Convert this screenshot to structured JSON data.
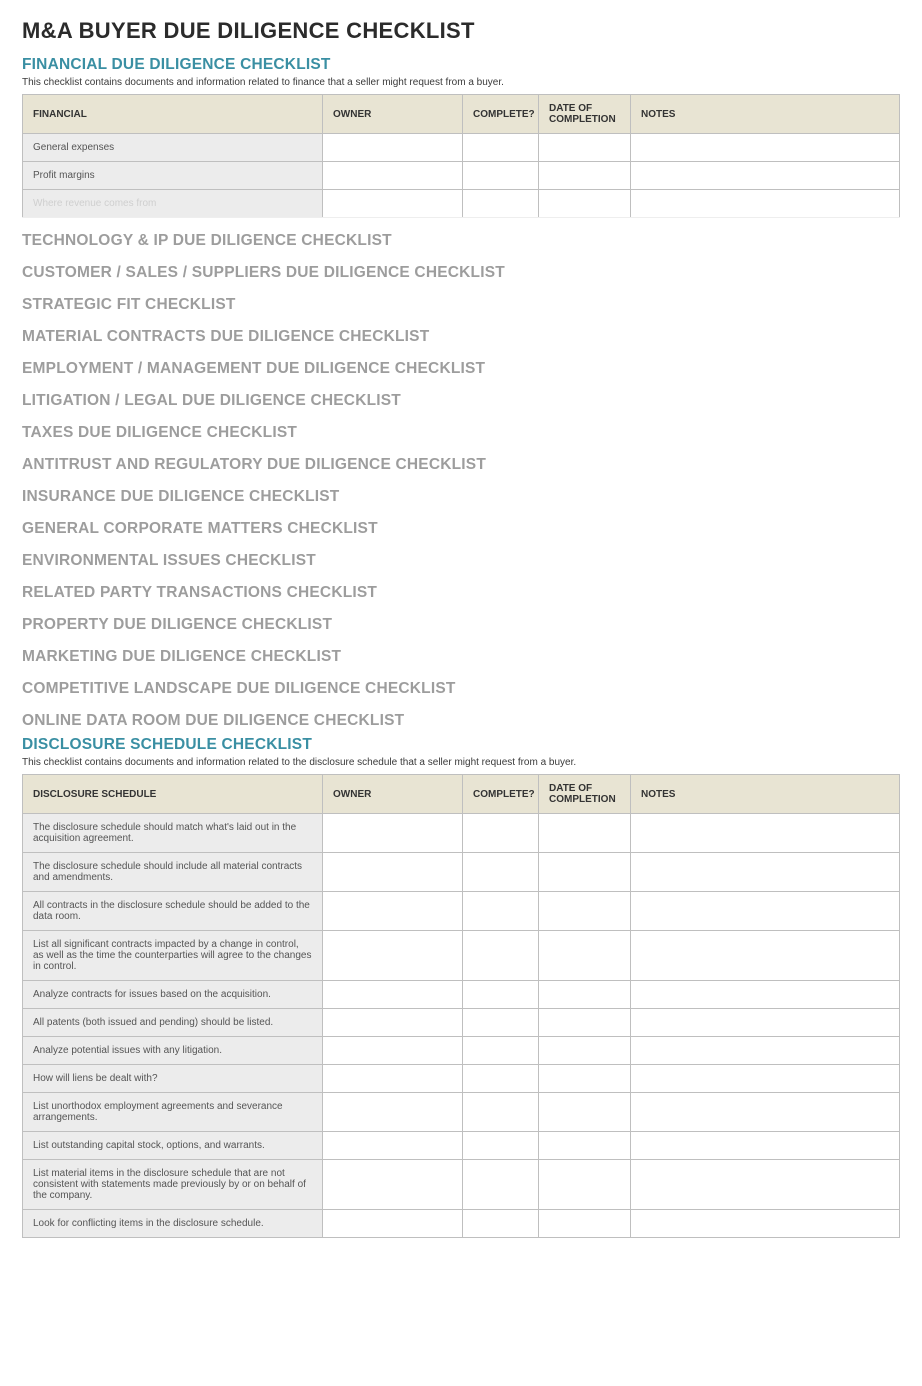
{
  "title": "M&A BUYER DUE DILIGENCE CHECKLIST",
  "columns": {
    "owner": "OWNER",
    "complete": "COMPLETE?",
    "date": "DATE OF COMPLETION",
    "notes": "NOTES"
  },
  "financial": {
    "heading": "FINANCIAL DUE DILIGENCE CHECKLIST",
    "desc": "This checklist contains documents and information related to finance that a seller might request from a buyer.",
    "colhead": "FINANCIAL",
    "rows": [
      {
        "label": "General expenses",
        "owner": "",
        "complete": "",
        "date": "",
        "notes": ""
      },
      {
        "label": "Profit margins",
        "owner": "",
        "complete": "",
        "date": "",
        "notes": ""
      },
      {
        "label": "Where revenue comes from",
        "owner": "",
        "complete": "",
        "date": "",
        "notes": "",
        "fade": true
      }
    ]
  },
  "collapsed_sections": [
    "TECHNOLOGY & IP DUE DILIGENCE CHECKLIST",
    "CUSTOMER / SALES / SUPPLIERS DUE DILIGENCE CHECKLIST",
    "STRATEGIC FIT CHECKLIST",
    "MATERIAL CONTRACTS DUE DILIGENCE CHECKLIST",
    "EMPLOYMENT / MANAGEMENT DUE DILIGENCE CHECKLIST",
    "LITIGATION / LEGAL DUE DILIGENCE CHECKLIST",
    "TAXES DUE DILIGENCE CHECKLIST",
    "ANTITRUST AND REGULATORY DUE DILIGENCE CHECKLIST",
    "INSURANCE DUE DILIGENCE CHECKLIST",
    "GENERAL CORPORATE MATTERS CHECKLIST",
    "ENVIRONMENTAL ISSUES CHECKLIST",
    "RELATED PARTY TRANSACTIONS CHECKLIST",
    "PROPERTY DUE DILIGENCE CHECKLIST",
    "MARKETING DUE DILIGENCE CHECKLIST",
    "COMPETITIVE LANDSCAPE DUE DILIGENCE CHECKLIST",
    "ONLINE DATA ROOM DUE DILIGENCE CHECKLIST"
  ],
  "disclosure": {
    "heading": "DISCLOSURE SCHEDULE CHECKLIST",
    "desc": "This checklist contains documents and information related to the disclosure schedule that a seller might request from a buyer.",
    "colhead": "DISCLOSURE SCHEDULE",
    "rows": [
      {
        "label": "The disclosure schedule should match what's laid out in the acquisition agreement.",
        "owner": "",
        "complete": "",
        "date": "",
        "notes": ""
      },
      {
        "label": "The disclosure schedule should include all material contracts and amendments.",
        "owner": "",
        "complete": "",
        "date": "",
        "notes": ""
      },
      {
        "label": "All contracts in the disclosure schedule should be added to the data room.",
        "owner": "",
        "complete": "",
        "date": "",
        "notes": ""
      },
      {
        "label": "List all significant contracts impacted by a change in control, as well as the time the counterparties will agree to the changes in control.",
        "owner": "",
        "complete": "",
        "date": "",
        "notes": ""
      },
      {
        "label": "Analyze contracts for issues based on the acquisition.",
        "owner": "",
        "complete": "",
        "date": "",
        "notes": ""
      },
      {
        "label": "All patents (both issued and pending) should be listed.",
        "owner": "",
        "complete": "",
        "date": "",
        "notes": ""
      },
      {
        "label": "Analyze potential issues with any litigation.",
        "owner": "",
        "complete": "",
        "date": "",
        "notes": ""
      },
      {
        "label": "How will liens be dealt with?",
        "owner": "",
        "complete": "",
        "date": "",
        "notes": ""
      },
      {
        "label": "List unorthodox employment agreements and severance arrangements.",
        "owner": "",
        "complete": "",
        "date": "",
        "notes": ""
      },
      {
        "label": "List outstanding capital stock, options, and warrants.",
        "owner": "",
        "complete": "",
        "date": "",
        "notes": ""
      },
      {
        "label": "List material items in the disclosure schedule that are not consistent with statements made previously by or on behalf of the company.",
        "owner": "",
        "complete": "",
        "date": "",
        "notes": ""
      },
      {
        "label": "Look for conflicting items in the disclosure schedule.",
        "owner": "",
        "complete": "",
        "date": "",
        "notes": ""
      }
    ]
  }
}
